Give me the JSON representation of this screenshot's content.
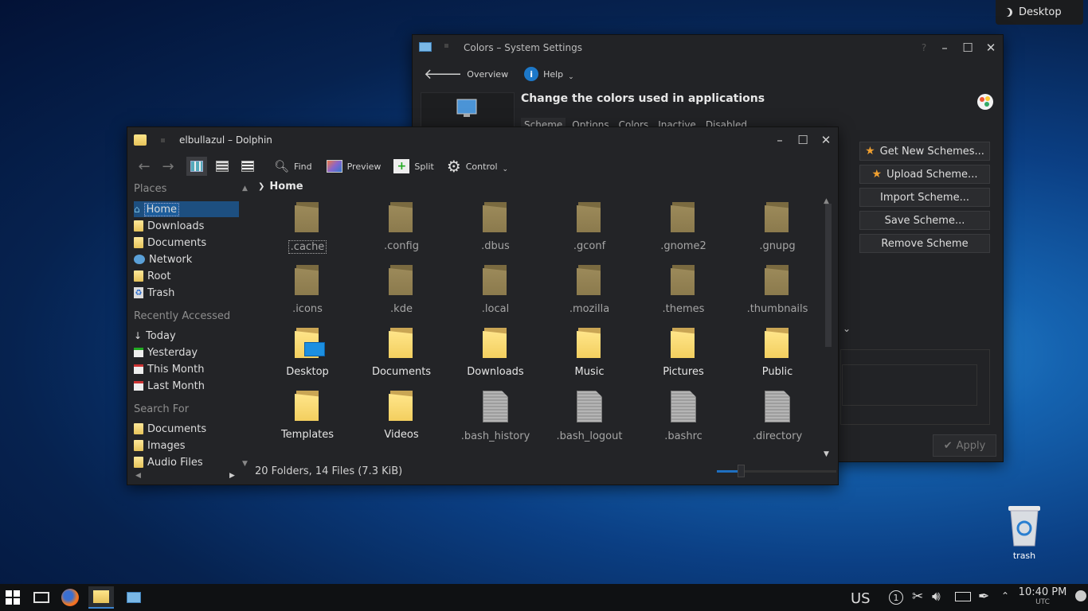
{
  "desktop": {
    "pager_label": "Desktop",
    "trash_label": "trash"
  },
  "settings": {
    "title": "Colors – System Settings",
    "toolbar": {
      "overview": "Overview",
      "help": "Help"
    },
    "heading": "Change the colors used in applications",
    "tabs": [
      "Scheme",
      "Options",
      "Colors",
      "Inactive",
      "Disabled"
    ],
    "buttons": {
      "get_new": "Get New Schemes...",
      "upload": "Upload Scheme...",
      "import": "Import Scheme...",
      "save": "Save Scheme...",
      "remove": "Remove Scheme",
      "apply": "Apply"
    }
  },
  "dolphin": {
    "title": "elbullazul – Dolphin",
    "toolbar": {
      "find": "Find",
      "preview": "Preview",
      "split": "Split",
      "control": "Control"
    },
    "breadcrumb": "Home",
    "places": {
      "title": "Places",
      "items": [
        "Home",
        "Downloads",
        "Documents",
        "Network",
        "Root",
        "Trash"
      ]
    },
    "recent": {
      "title": "Recently Accessed",
      "items": [
        "Today",
        "Yesterday",
        "This Month",
        "Last Month"
      ]
    },
    "search": {
      "title": "Search For",
      "items": [
        "Documents",
        "Images",
        "Audio Files"
      ]
    },
    "files": [
      ".cache",
      ".config",
      ".dbus",
      ".gconf",
      ".gnome2",
      ".gnupg",
      ".icons",
      ".kde",
      ".local",
      ".mozilla",
      ".themes",
      ".thumbnails",
      "Desktop",
      "Documents",
      "Downloads",
      "Music",
      "Pictures",
      "Public",
      "Templates",
      "Videos",
      ".bash_history",
      ".bash_logout",
      ".bashrc",
      ".directory"
    ],
    "status": "20 Folders, 14 Files (7.3 KiB)"
  },
  "taskbar": {
    "keyboard_layout": "US",
    "clock_time": "10:40 PM",
    "clock_tz": "UTC"
  }
}
